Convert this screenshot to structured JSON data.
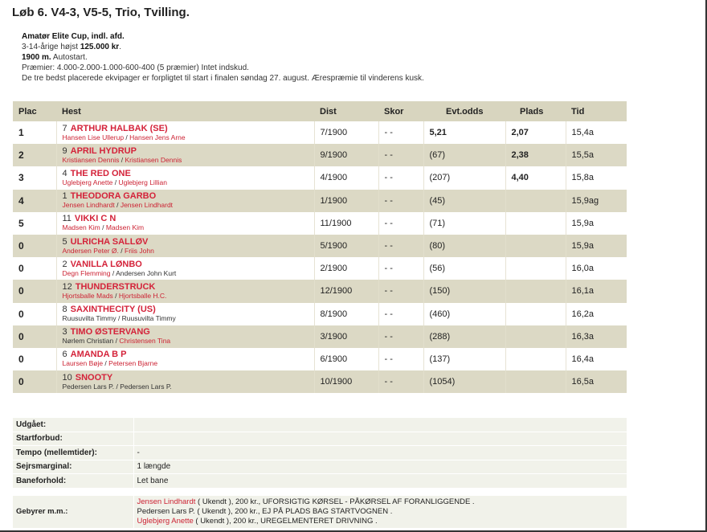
{
  "page_title": "Løb 6. V4-3, V5-5, Trio, Tvilling.",
  "race_info": {
    "name": "Amatør Elite Cup, indl. afd.",
    "conditions_prefix": "3-14-årige højst ",
    "conditions_amount": "125.000 kr",
    "conditions_suffix": ".",
    "distance": "1900 m.",
    "start_type": " Autostart.",
    "prizes": "Præmier: 4.000-2.000-1.000-600-400 (5 præmier) Intet indskud.",
    "note": "De tre bedst placerede ekvipager er forpligtet til start i finalen søndag 27. august. Ærespræmie til vinderens kusk."
  },
  "table_headers": {
    "plac": "Plac",
    "hest": "Hest",
    "dist": "Dist",
    "skor": "Skor",
    "odds": "Evt.odds",
    "plads": "Plads",
    "tid": "Tid"
  },
  "results": [
    {
      "plac": "1",
      "num": "7",
      "name": "ARTHUR HALBAK (SE)",
      "trainer": "Hansen Lise Ullerup",
      "driver": "Hansen Jens Arne",
      "trainer_link": true,
      "driver_link": true,
      "dist": "7/1900",
      "skor": "- -",
      "odds": "5,21",
      "odds_bold": true,
      "plads": "2,07",
      "tid": "15,4a"
    },
    {
      "plac": "2",
      "num": "9",
      "name": "APRIL HYDRUP",
      "trainer": "Kristiansen Dennis",
      "driver": "Kristiansen Dennis",
      "trainer_link": true,
      "driver_link": true,
      "dist": "9/1900",
      "skor": "- -",
      "odds": "(67)",
      "odds_bold": false,
      "plads": "2,38",
      "tid": "15,5a"
    },
    {
      "plac": "3",
      "num": "4",
      "name": "THE RED ONE",
      "trainer": "Uglebjerg Anette",
      "driver": "Uglebjerg Lillian",
      "trainer_link": true,
      "driver_link": true,
      "dist": "4/1900",
      "skor": "- -",
      "odds": "(207)",
      "odds_bold": false,
      "plads": "4,40",
      "tid": "15,8a"
    },
    {
      "plac": "4",
      "num": "1",
      "name": "THEODORA GARBO",
      "trainer": "Jensen Lindhardt",
      "driver": "Jensen Lindhardt",
      "trainer_link": true,
      "driver_link": true,
      "dist": "1/1900",
      "skor": "- -",
      "odds": "(45)",
      "odds_bold": false,
      "plads": "",
      "tid": "15,9ag"
    },
    {
      "plac": "5",
      "num": "11",
      "name": "VIKKI C N",
      "trainer": "Madsen Kim",
      "driver": "Madsen Kim",
      "trainer_link": true,
      "driver_link": true,
      "dist": "11/1900",
      "skor": "- -",
      "odds": "(71)",
      "odds_bold": false,
      "plads": "",
      "tid": "15,9a"
    },
    {
      "plac": "0",
      "num": "5",
      "name": "ULRICHA SALLØV",
      "trainer": "Andersen Peter Ø.",
      "driver": "Friis John",
      "trainer_link": true,
      "driver_link": true,
      "dist": "5/1900",
      "skor": "- -",
      "odds": "(80)",
      "odds_bold": false,
      "plads": "",
      "tid": "15,9a"
    },
    {
      "plac": "0",
      "num": "2",
      "name": "VANILLA LØNBO",
      "trainer": "Degn Flemming",
      "driver": "Andersen John Kurt",
      "trainer_link": true,
      "driver_link": false,
      "dist": "2/1900",
      "skor": "- -",
      "odds": "(56)",
      "odds_bold": false,
      "plads": "",
      "tid": "16,0a"
    },
    {
      "plac": "0",
      "num": "12",
      "name": "THUNDERSTRUCK",
      "trainer": "Hjortsballe Mads",
      "driver": "Hjortsballe H.C.",
      "trainer_link": true,
      "driver_link": true,
      "dist": "12/1900",
      "skor": "- -",
      "odds": "(150)",
      "odds_bold": false,
      "plads": "",
      "tid": "16,1a"
    },
    {
      "plac": "0",
      "num": "8",
      "name": "SAXINTHECITY (US)",
      "trainer": "Ruusuvilta Timmy",
      "driver": "Ruusuvilta Timmy",
      "trainer_link": false,
      "driver_link": false,
      "dist": "8/1900",
      "skor": "- -",
      "odds": "(460)",
      "odds_bold": false,
      "plads": "",
      "tid": "16,2a"
    },
    {
      "plac": "0",
      "num": "3",
      "name": "TIMO ØSTERVANG",
      "trainer": "Nørlem Christian",
      "driver": "Christensen Tina",
      "trainer_link": false,
      "driver_link": true,
      "dist": "3/1900",
      "skor": "- -",
      "odds": "(288)",
      "odds_bold": false,
      "plads": "",
      "tid": "16,3a"
    },
    {
      "plac": "0",
      "num": "6",
      "name": "AMANDA B P",
      "trainer": "Laursen Bøje",
      "driver": "Petersen Bjarne",
      "trainer_link": true,
      "driver_link": true,
      "dist": "6/1900",
      "skor": "- -",
      "odds": "(137)",
      "odds_bold": false,
      "plads": "",
      "tid": "16,4a"
    },
    {
      "plac": "0",
      "num": "10",
      "name": "SNOOTY",
      "trainer": "Pedersen Lars P.",
      "driver": "Pedersen Lars P.",
      "trainer_link": false,
      "driver_link": false,
      "dist": "10/1900",
      "skor": "- -",
      "odds": "(1054)",
      "odds_bold": false,
      "plads": "",
      "tid": "16,5a"
    }
  ],
  "extra": {
    "udgaaet_label": "Udgået:",
    "udgaaet_value": "",
    "startforbud_label": "Startforbud:",
    "startforbud_value": "",
    "tempo_label": "Tempo (mellemtider):",
    "tempo_value": "-",
    "sejrsmarginal_label": "Sejrsmarginal:",
    "sejrsmarginal_value": "1 længde",
    "baneforhold_label": "Baneforhold:",
    "baneforhold_value": "Let bane",
    "gebyrer_label": "Gebyrer m.m.:",
    "gebyrer": [
      {
        "name": "Jensen Lindhardt",
        "name_link": true,
        "text": " ( Ukendt ), 200 kr., UFORSIGTIG KØRSEL - PÅKØRSEL AF FORANLIGGENDE ."
      },
      {
        "name": "Pedersen Lars P.",
        "name_link": false,
        "text": " ( Ukendt ), 200 kr., EJ PÅ PLADS BAG STARTVOGNEN ."
      },
      {
        "name": "Uglebjerg Anette",
        "name_link": true,
        "text": " ( Ukendt ), 200 kr., UREGELMENTERET DRIVNING ."
      }
    ]
  },
  "colors": {
    "header_bg": "#d8d5bf",
    "even_row_bg": "#dcd9c5",
    "link_red": "#d4233a",
    "extra_bg": "#f1f2ea"
  }
}
